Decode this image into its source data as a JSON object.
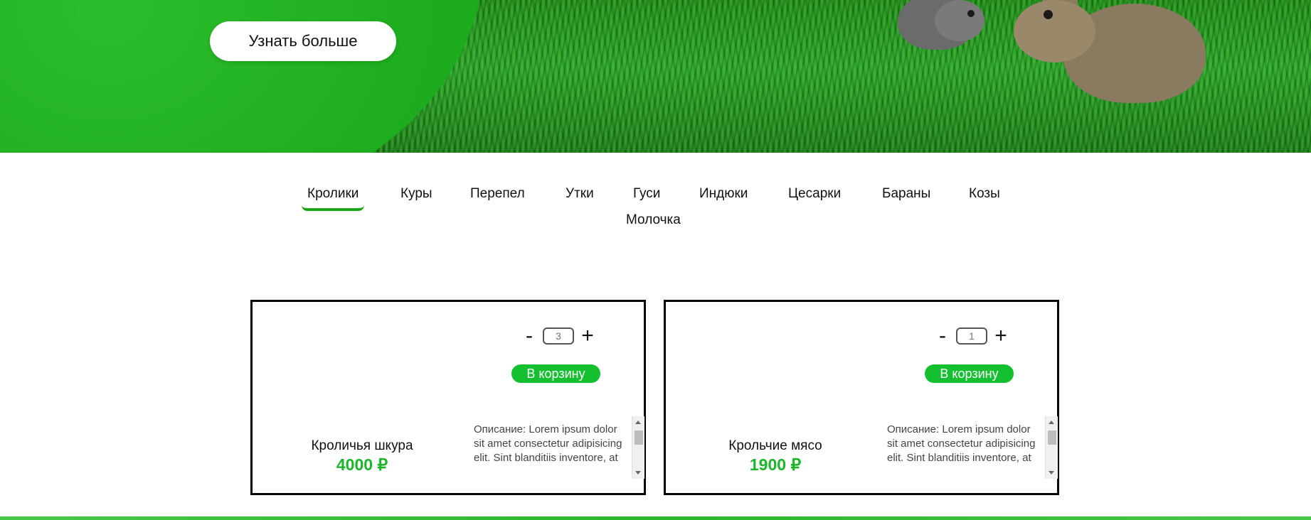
{
  "hero": {
    "cta_label": "Узнать больше"
  },
  "nav": {
    "items": [
      "Кролики",
      "Куры",
      "Перепел",
      "Утки",
      "Гуси",
      "Индюки",
      "Цесарки",
      "Бараны",
      "Козы",
      "Молочка"
    ],
    "active_index": 0
  },
  "products": [
    {
      "title": "Кроличья шкура",
      "price": "4000 ₽",
      "quantity": "3",
      "qty_minus": "-",
      "qty_plus": "+",
      "cart_label": "В корзину",
      "description": "Описание: Lorem ipsum dolor sit amet consectetur adipisicing elit. Sint blanditiis inventore, at"
    },
    {
      "title": "Крольчие мясо",
      "price": "1900 ₽",
      "quantity": "1",
      "qty_minus": "-",
      "qty_plus": "+",
      "cart_label": "В корзину",
      "description": "Описание: Lorem ipsum dolor sit amet consectetur adipisicing elit. Sint blanditiis inventore, at"
    }
  ],
  "colors": {
    "accent_green": "#15c030",
    "price_green": "#1cb52a",
    "hero_green": "#1faa1f"
  }
}
